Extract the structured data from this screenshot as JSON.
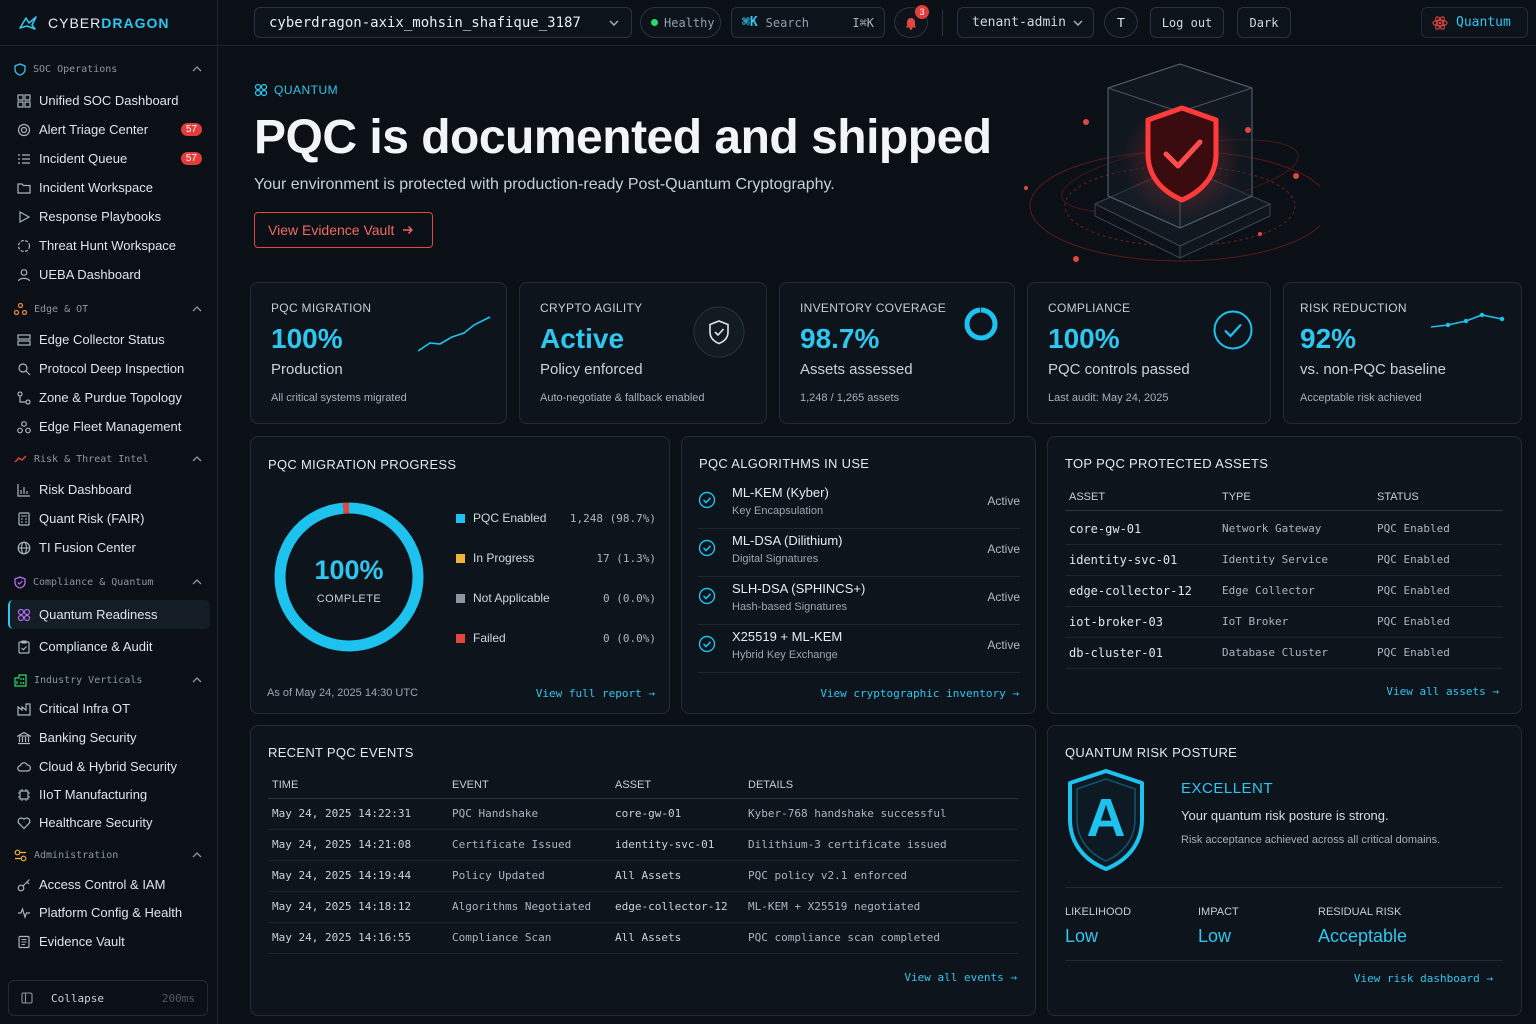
{
  "brand": {
    "prefix": "CYBER",
    "suffix": "DRAGON"
  },
  "topbar": {
    "tenant": "cyberdragon-axix_mohsin_shafique_3187",
    "health": "Healthy",
    "search_shortcut": "⌘K",
    "search_label": "Search",
    "search_hint": "I⌘K",
    "notifications_count": "3",
    "role": "tenant-admin",
    "avatar_initial": "T",
    "logout": "Log out",
    "theme": "Dark",
    "module": "Quantum"
  },
  "sidebar": {
    "sections": [
      {
        "title": "SOC Operations",
        "icon": "shield-icon",
        "color": "#2fc6ef"
      },
      {
        "title": "Edge & OT",
        "icon": "network-nodes-icon",
        "color": "#f08a3c"
      },
      {
        "title": "Risk & Threat Intel",
        "icon": "trend-icon",
        "color": "#e2473f"
      },
      {
        "title": "Compliance & Quantum",
        "icon": "shield-check-icon",
        "color": "#b06bf0"
      },
      {
        "title": "Industry Verticals",
        "icon": "building-icon",
        "color": "#2bd96b"
      },
      {
        "title": "Administration",
        "icon": "admin-icon",
        "color": "#f0b43c"
      }
    ],
    "items": [
      {
        "label": "Unified SOC Dashboard",
        "icon": "grid-icon"
      },
      {
        "label": "Alert Triage Center",
        "icon": "radar-icon",
        "badge": "57"
      },
      {
        "label": "Incident Queue",
        "icon": "list-icon",
        "badge": "57"
      },
      {
        "label": "Incident Workspace",
        "icon": "folder-icon"
      },
      {
        "label": "Response Playbooks",
        "icon": "play-icon"
      },
      {
        "label": "Threat Hunt Workspace",
        "icon": "crosshair-icon"
      },
      {
        "label": "UEBA Dashboard",
        "icon": "user-icon"
      },
      {
        "label": "Edge Collector Status",
        "icon": "server-icon"
      },
      {
        "label": "Protocol Deep Inspection",
        "icon": "inspect-icon"
      },
      {
        "label": "Zone & Purdue Topology",
        "icon": "topology-icon"
      },
      {
        "label": "Edge Fleet Management",
        "icon": "fleet-icon"
      },
      {
        "label": "Risk Dashboard",
        "icon": "bar-chart-icon"
      },
      {
        "label": "Quant Risk (FAIR)",
        "icon": "calculator-icon"
      },
      {
        "label": "TI Fusion Center",
        "icon": "globe-icon"
      },
      {
        "label": "Quantum Readiness",
        "icon": "atom-icon"
      },
      {
        "label": "Compliance & Audit",
        "icon": "clipboard-icon"
      },
      {
        "label": "Critical Infra OT",
        "icon": "factory-icon"
      },
      {
        "label": "Banking Security",
        "icon": "bank-icon"
      },
      {
        "label": "Cloud & Hybrid Security",
        "icon": "cloud-icon"
      },
      {
        "label": "IIoT Manufacturing",
        "icon": "chip-icon"
      },
      {
        "label": "Healthcare Security",
        "icon": "heart-icon"
      },
      {
        "label": "Access Control & IAM",
        "icon": "key-icon"
      },
      {
        "label": "Platform Config & Health",
        "icon": "pulse-icon"
      },
      {
        "label": "Evidence Vault",
        "icon": "archive-icon"
      }
    ],
    "collapse_label": "Collapse",
    "collapse_latency": "200ms"
  },
  "hero": {
    "tag": "QUANTUM",
    "title": "PQC is documented and shipped",
    "subtitle": "Your environment is protected with production-ready Post-Quantum Cryptography.",
    "cta": "View Evidence Vault"
  },
  "kpis": [
    {
      "label": "PQC MIGRATION",
      "value": "100%",
      "sub": "Production",
      "foot": "All critical systems migrated",
      "icon": "trend-sparkline-icon"
    },
    {
      "label": "CRYPTO AGILITY",
      "value": "Active",
      "sub": "Policy enforced",
      "foot": "Auto-negotiate & fallback enabled",
      "icon": "shield-check-icon"
    },
    {
      "label": "INVENTORY COVERAGE",
      "value": "98.7%",
      "sub": "Assets assessed",
      "foot": "1,248 / 1,265 assets",
      "icon": "donut-progress-icon",
      "progress": 0.987
    },
    {
      "label": "COMPLIANCE",
      "value": "100%",
      "sub": "PQC controls passed",
      "foot": "Last audit: May 24, 2025",
      "icon": "check-circle-icon"
    },
    {
      "label": "RISK REDUCTION",
      "value": "92%",
      "sub": "vs. non-PQC baseline",
      "foot": "Acceptable risk achieved",
      "icon": "trend-sparkline-icon"
    }
  ],
  "migration": {
    "title": "PQC MIGRATION PROGRESS",
    "center_value": "100%",
    "center_label": "COMPLETE",
    "as_of": "As of May 24, 2025 14:30 UTC",
    "link": "View full report",
    "legend": [
      {
        "label": "PQC Enabled",
        "count": "1,248 (98.7%)",
        "color": "#1ec2ef"
      },
      {
        "label": "In Progress",
        "count": "17 (1.3%)",
        "color": "#f0b43c"
      },
      {
        "label": "Not Applicable",
        "count": "0 (0.0%)",
        "color": "#8a95a2"
      },
      {
        "label": "Failed",
        "count": "0 (0.0%)",
        "color": "#e2473f"
      }
    ]
  },
  "chart_data": {
    "type": "pie",
    "categories": [
      "PQC Enabled",
      "In Progress",
      "Not Applicable",
      "Failed"
    ],
    "values": [
      1248,
      17,
      0,
      0
    ],
    "title": "PQC MIGRATION PROGRESS"
  },
  "algorithms": {
    "title": "PQC ALGORITHMS IN USE",
    "items": [
      {
        "name": "ML-KEM (Kyber)",
        "desc": "Key Encapsulation",
        "status": "Active"
      },
      {
        "name": "ML-DSA (Dilithium)",
        "desc": "Digital Signatures",
        "status": "Active"
      },
      {
        "name": "SLH-DSA (SPHINCS+)",
        "desc": "Hash-based Signatures",
        "status": "Active"
      },
      {
        "name": "X25519 + ML-KEM",
        "desc": "Hybrid Key Exchange",
        "status": "Active"
      }
    ],
    "link": "View cryptographic inventory"
  },
  "assets": {
    "title": "TOP PQC PROTECTED ASSETS",
    "columns": [
      "ASSET",
      "TYPE",
      "STATUS"
    ],
    "rows": [
      [
        "core-gw-01",
        "Network Gateway",
        "PQC Enabled"
      ],
      [
        "identity-svc-01",
        "Identity Service",
        "PQC Enabled"
      ],
      [
        "edge-collector-12",
        "Edge Collector",
        "PQC Enabled"
      ],
      [
        "iot-broker-03",
        "IoT Broker",
        "PQC Enabled"
      ],
      [
        "db-cluster-01",
        "Database Cluster",
        "PQC Enabled"
      ]
    ],
    "link": "View all assets"
  },
  "events": {
    "title": "RECENT PQC EVENTS",
    "columns": [
      "TIME",
      "EVENT",
      "ASSET",
      "DETAILS"
    ],
    "rows": [
      [
        "May 24, 2025 14:22:31",
        "PQC Handshake",
        "core-gw-01",
        "Kyber-768 handshake successful"
      ],
      [
        "May 24, 2025 14:21:08",
        "Certificate Issued",
        "identity-svc-01",
        "Dilithium-3 certificate issued"
      ],
      [
        "May 24, 2025 14:19:44",
        "Policy Updated",
        "All Assets",
        "PQC policy v2.1 enforced"
      ],
      [
        "May 24, 2025 14:18:12",
        "Algorithms Negotiated",
        "edge-collector-12",
        "ML-KEM + X25519 negotiated"
      ],
      [
        "May 24, 2025 14:16:55",
        "Compliance Scan",
        "All Assets",
        "PQC compliance scan completed"
      ]
    ],
    "link": "View all events"
  },
  "risk": {
    "title": "QUANTUM RISK POSTURE",
    "grade": "A",
    "level": "EXCELLENT",
    "message": "Your quantum risk posture is strong.",
    "sub": "Risk acceptance achieved across all critical domains.",
    "metrics": [
      {
        "label": "LIKELIHOOD",
        "value": "Low"
      },
      {
        "label": "IMPACT",
        "value": "Low"
      },
      {
        "label": "RESIDUAL RISK",
        "value": "Acceptable"
      }
    ],
    "link": "View risk dashboard"
  }
}
